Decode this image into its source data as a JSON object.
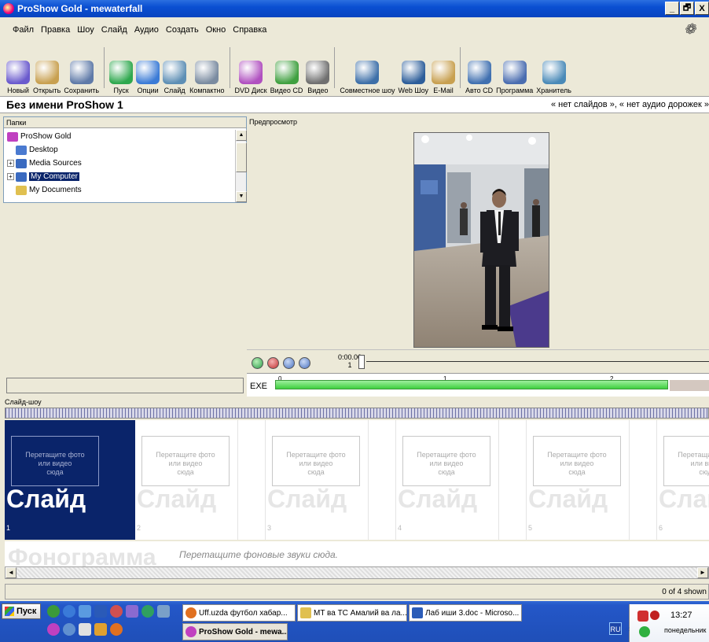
{
  "window": {
    "title": "ProShow Gold - mewaterfall",
    "btn_min": "_",
    "btn_max": "🗗",
    "btn_close": "X"
  },
  "menu": [
    "Файл",
    "Правка",
    "Шоу",
    "Слайд",
    "Аудио",
    "Создать",
    "Окно",
    "Справка"
  ],
  "toolbar": [
    {
      "label": "Новый",
      "icon": "new-icon",
      "color": "#6a5acd"
    },
    {
      "label": "Открыть",
      "icon": "open-icon",
      "color": "#c8a050"
    },
    {
      "label": "Сохранить",
      "icon": "save-icon",
      "color": "#5f7aa8"
    },
    {
      "label": "Пуск",
      "icon": "play-icon",
      "color": "#2ea84e"
    },
    {
      "label": "Опции",
      "icon": "options-icon",
      "color": "#3b7bd6"
    },
    {
      "label": "Слайд",
      "icon": "slide-icon",
      "color": "#5e8fb5"
    },
    {
      "label": "Компактно",
      "icon": "compact-icon",
      "color": "#7a8ba0"
    },
    {
      "label": "DVD Диск",
      "icon": "dvd-icon",
      "color": "#b050c0"
    },
    {
      "label": "Видео CD",
      "icon": "vcd-icon",
      "color": "#40a040"
    },
    {
      "label": "Видео",
      "icon": "video-icon",
      "color": "#707070"
    },
    {
      "label": "Совместное шоу",
      "icon": "share-icon",
      "color": "#3d6fa8"
    },
    {
      "label": "Web Шоу",
      "icon": "web-icon",
      "color": "#2d5e9a"
    },
    {
      "label": "E-Mail",
      "icon": "email-icon",
      "color": "#c8a050"
    },
    {
      "label": "Авто CD",
      "icon": "autocd-icon",
      "color": "#4070b0"
    },
    {
      "label": "Программа",
      "icon": "program-icon",
      "color": "#4a6db0"
    },
    {
      "label": "Хранитель",
      "icon": "saver-icon",
      "color": "#4a8ab8"
    }
  ],
  "project": {
    "title": "Без имени ProShow 1",
    "info": "« нет слайдов », « нет аудио дорожек »"
  },
  "folders": {
    "header": "Папки",
    "items": [
      {
        "label": "ProShow Gold",
        "expander": "",
        "color": "#c040c0"
      },
      {
        "label": "Desktop",
        "expander": "",
        "color": "#4a7ad0"
      },
      {
        "label": "Media Sources",
        "expander": "+",
        "color": "#3a6ac0"
      },
      {
        "label": "My Computer",
        "expander": "+",
        "color": "#3a6ac0"
      },
      {
        "label": "My Documents",
        "expander": "",
        "color": "#e0c050"
      }
    ],
    "scroll_up": "▲",
    "scroll_down": "▼"
  },
  "preview": {
    "header": "Предпросмотр",
    "time": "0:00.00",
    "frame": "1"
  },
  "timeline": {
    "exe": "EXE",
    "ticks": [
      "0",
      "1",
      "2"
    ]
  },
  "slideshow": {
    "header": "Слайд-шоу",
    "placeholder_line1": "Перетащите фото",
    "placeholder_line2": "или видео",
    "placeholder_line3": "сюда",
    "big_label": "Слайд",
    "slots": [
      "1",
      "2",
      "3",
      "4",
      "5",
      "6"
    ]
  },
  "soundtrack": {
    "big": "Фонограмма",
    "hint": "Перетащите фоновые звуки сюда."
  },
  "hscroll": {
    "left": "◄",
    "right": "►"
  },
  "status": {
    "right": "0 of 4 shown"
  },
  "taskbar": {
    "start": "Пуск",
    "buttons": [
      {
        "label": "Uff.uzda футбол хабар...",
        "icon": "firefox-icon",
        "color": "#e07020"
      },
      {
        "label": "MT ва ТС Амалий ва ла...",
        "icon": "folder-icon",
        "color": "#e0c050"
      },
      {
        "label": "Лаб иши 3.doc - Microso...",
        "icon": "word-icon",
        "color": "#2b5cb8"
      },
      {
        "label": "ProShow Gold - mewa...",
        "icon": "proshow-icon",
        "color": "#c040c0"
      }
    ],
    "lang": "RU",
    "tray_chevron": "«",
    "clock": "13:27",
    "day": "понедельник"
  }
}
